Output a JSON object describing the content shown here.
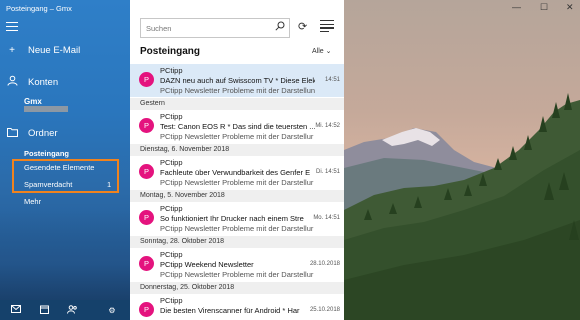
{
  "window": {
    "title": "Posteingang – Gmx",
    "controls": [
      "—",
      "☐",
      "✕"
    ]
  },
  "nav": {
    "new_mail": "Neue E-Mail",
    "accounts_label": "Konten",
    "account_name": "Gmx",
    "folders_label": "Ordner",
    "folders": [
      {
        "label": "Posteingang",
        "count": ""
      },
      {
        "label": "Gesendete Elemente",
        "count": ""
      },
      {
        "label": "Spamverdacht",
        "count": "1"
      }
    ],
    "more": "Mehr",
    "icons": [
      "menu-icon",
      "compose-icon",
      "person-icon",
      "folder-icon",
      "mail-icon",
      "calendar-icon",
      "people-icon",
      "gear-icon"
    ]
  },
  "list": {
    "search_placeholder": "Suchen",
    "title": "Posteingang",
    "filter": "Alle",
    "messages": [
      {
        "from": "PCtipp",
        "subject": "DAZN neu auch auf Swisscom TV  * Diese Elekt",
        "preview": "PCtipp Newsletter Probleme mit der Darstellun",
        "time": "14:51",
        "selected": true
      },
      {
        "group": "Gestern"
      },
      {
        "from": "PCtipp",
        "subject": "Test: Canon EOS R * Das sind die teuersten ...",
        "preview": "PCtipp Newsletter Probleme mit der Darstellur",
        "time": "Mi. 14:52"
      },
      {
        "group": "Dienstag, 6. November 2018"
      },
      {
        "from": "PCtipp",
        "subject": "Fachleute über Verwundbarkeit des Genfer E",
        "preview": "PCtipp Newsletter Probleme mit der Darstellur",
        "time": "Di. 14:51"
      },
      {
        "group": "Montag, 5. November 2018"
      },
      {
        "from": "PCtipp",
        "subject": "So funktioniert Ihr Drucker nach einem Stre",
        "preview": "PCtipp Newsletter Probleme mit der Darstellur",
        "time": "Mo. 14:51"
      },
      {
        "group": "Sonntag, 28. Oktober 2018"
      },
      {
        "from": "PCtipp",
        "subject": "PCtipp Weekend Newsletter",
        "preview": "PCtipp Newsletter Probleme mit der Darstellur",
        "time": "28.10.2018"
      },
      {
        "group": "Donnerstag, 25. Oktober 2018"
      },
      {
        "from": "PCtipp",
        "subject": "Die besten Virenscanner für Android * Har",
        "preview": "",
        "time": "25.10.2018"
      }
    ]
  },
  "colors": {
    "nav_bg": "#2a76bd",
    "avatar": "#e4137e",
    "highlight": "#f0831e",
    "selected_row": "#dbe9f7"
  }
}
